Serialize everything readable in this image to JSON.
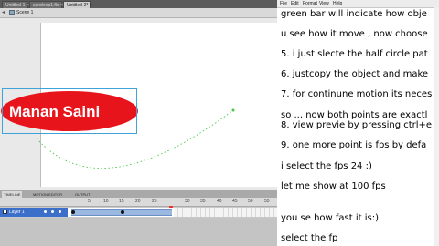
{
  "flash": {
    "doc_tabs": [
      {
        "label": "Untitled-1 ×",
        "active": false
      },
      {
        "label": "sandeep1.fla ×",
        "active": false
      },
      {
        "label": "Untitled-2* ×",
        "active": true
      }
    ],
    "scene_label": "Scene 1",
    "ellipse_text": "Manan Saini",
    "ellipse_color": "#e8141c",
    "timeline": {
      "tabs": [
        "TIMELINE",
        "MOTION EDITOR",
        "OUTPUT"
      ],
      "ruler": [
        "5",
        "10",
        "15",
        "20",
        "25",
        "30",
        "35",
        "40",
        "45",
        "50",
        "55"
      ],
      "layer_name": "Layer 1",
      "playhead_frame": "24"
    }
  },
  "notepad": {
    "menu": [
      "File",
      "Edit",
      "Format",
      "View",
      "Help"
    ],
    "lines": [
      "green bar will indicate how obje",
      "u see how it move , now  choose",
      "5. i just slecte the half circle pat",
      "6. justcopy the object and make",
      "7. for continune motion its neces",
      "so ... now both points are exactl",
      "8. view previe by pressing ctrl+e",
      "9. one more point is fps by defa",
      "i select the fps 24 :)",
      "let me show at 100 fps",
      "you se how fast it is:)",
      "select the fp"
    ]
  }
}
